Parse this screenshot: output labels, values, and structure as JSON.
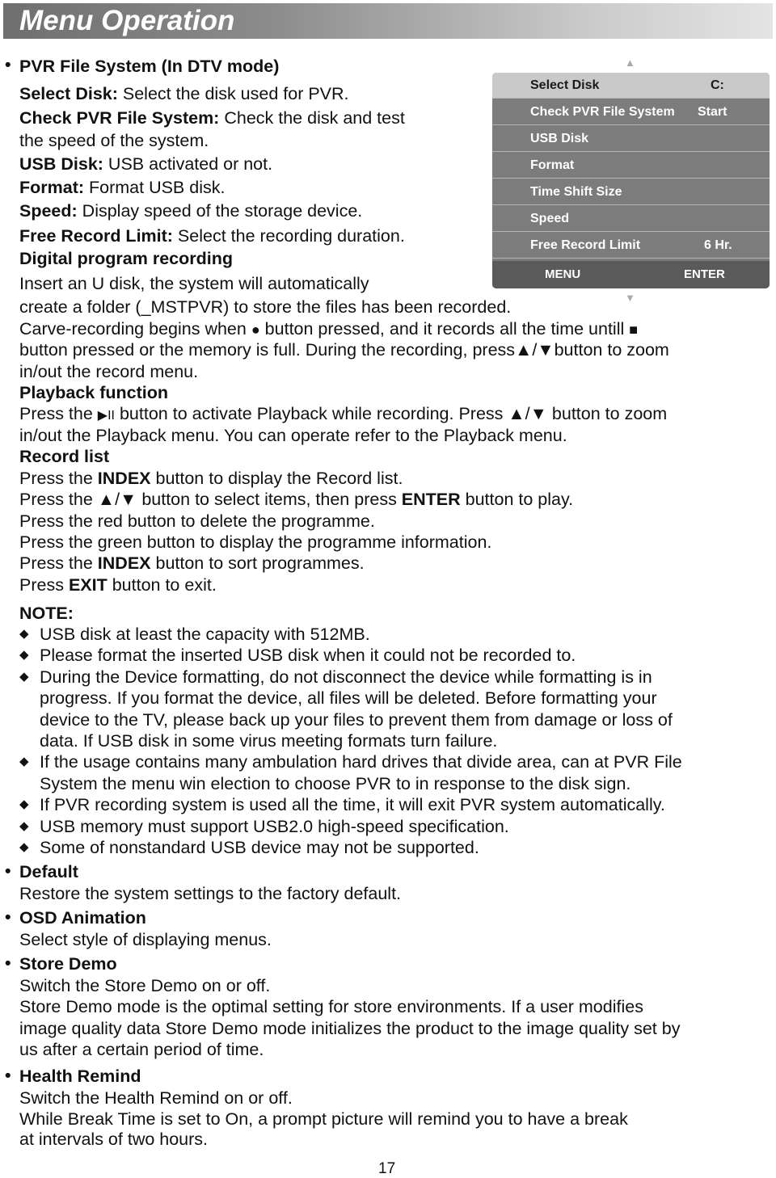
{
  "header": {
    "title": "Menu Operation"
  },
  "pvr": {
    "heading": "PVR File System (In DTV mode)",
    "items": [
      {
        "term": "Select Disk:",
        "desc": " Select the disk used for PVR."
      },
      {
        "term": "Check PVR File System:",
        "desc": " Check the disk and test"
      },
      {
        "term": "",
        "desc": "the speed of the system."
      },
      {
        "term": "USB Disk:",
        "desc": " USB activated or not."
      },
      {
        "term": "Format:",
        "desc": " Format USB disk."
      },
      {
        "term": "Speed:",
        "desc": " Display speed of the storage device."
      },
      {
        "term": "Free Record Limit:",
        "desc": " Select the recording duration."
      }
    ],
    "digital_heading": "Digital program recording",
    "digital_lines": [
      "Insert an U disk, the system will automatically",
      "create a folder (_MSTPVR) to store the files has been recorded."
    ],
    "carve": {
      "part1": "Carve-recording begins when ",
      "record_symbol": "●",
      "part2": " button pressed, and it records all the time untill ",
      "stop_symbol": "■",
      "line2a": "button pressed or the memory is full. During the recording, press",
      "updown_symbol": "▲/▼",
      "line2b": "button to zoom",
      "line3": "in/out the record menu."
    },
    "playback": {
      "heading": "Playback function",
      "line1a": "Press the ",
      "play_symbol": "▶II",
      "line1b": " button to activate Playback while recording. Press ",
      "updown_symbol": "▲/▼",
      "line1c": " button to zoom",
      "line2": "in/out the Playback menu. You can operate refer to the Playback menu."
    },
    "record_list": {
      "heading": "Record list",
      "l1a": "Press the ",
      "l1b": "INDEX",
      "l1c": " button to display the Record list.",
      "l2a": "Press the ",
      "l2sym": "▲/▼",
      "l2b": " button to select items, then press ",
      "l2c": "ENTER",
      "l2d": " button to play.",
      "l3": "Press the red button to delete the programme.",
      "l4": "Press the green button to display the programme information.",
      "l5a": "Press the ",
      "l5b": "INDEX",
      "l5c": " button to sort programmes.",
      "l6a": "Press ",
      "l6b": "EXIT",
      "l6c": " button to exit."
    }
  },
  "menu_panel": {
    "rows": [
      {
        "label": "Select Disk",
        "value": "C:"
      },
      {
        "label": "Check PVR File System",
        "value": "Start"
      },
      {
        "label": "USB Disk",
        "value": ""
      },
      {
        "label": "Format",
        "value": ""
      },
      {
        "label": "Time Shift Size",
        "value": ""
      },
      {
        "label": "Speed",
        "value": ""
      },
      {
        "label": "Free Record Limit",
        "value": "6 Hr."
      }
    ],
    "footer_left": "MENU",
    "footer_right": "ENTER",
    "arrow_up": "▲",
    "arrow_down": "▼"
  },
  "note": {
    "heading": "NOTE:",
    "bullet": "◆",
    "lines": [
      {
        "bullet": true,
        "text": "USB disk at least the capacity with 512MB."
      },
      {
        "bullet": true,
        "text": "Please format the inserted USB disk when it could not be recorded to."
      },
      {
        "bullet": true,
        "text": "During the Device formatting, do not disconnect the device while formatting is in"
      },
      {
        "bullet": false,
        "text": "progress. If you format the device, all files will be deleted. Before formatting your"
      },
      {
        "bullet": false,
        "text": "device to the TV, please back up your files to prevent them from damage or loss of"
      },
      {
        "bullet": false,
        "text": "data. If USB disk in some virus meeting formats turn failure."
      },
      {
        "bullet": true,
        "text": "If the usage contains many ambulation hard drives that divide area, can at PVR File"
      },
      {
        "bullet": false,
        "text": "System the menu win election to choose PVR to in response to the disk sign."
      },
      {
        "bullet": true,
        "text": "If PVR recording system is used all the time, it will exit PVR system automatically."
      },
      {
        "bullet": true,
        "text": "USB memory must support USB2.0 high-speed specification."
      },
      {
        "bullet": true,
        "text": "Some of nonstandard USB device may not be supported."
      }
    ]
  },
  "sections": {
    "bullet": "•",
    "default": {
      "heading": "Default",
      "lines": [
        "Restore the system settings to the factory default."
      ]
    },
    "osd": {
      "heading": "OSD Animation",
      "lines": [
        "Select style of displaying menus."
      ]
    },
    "store_demo": {
      "heading": "Store Demo",
      "lines": [
        "Switch the Store Demo on or off.",
        "Store Demo mode is the optimal setting for store environments. If a user modifies",
        "image quality data Store Demo mode initializes the product to the image quality set by",
        "us after a certain period of time."
      ]
    },
    "health": {
      "heading": "Health Remind",
      "lines": [
        "Switch the Health Remind on or off.",
        "While Break Time is set to On, a prompt picture will remind you to have a break",
        "at intervals of two hours."
      ]
    }
  },
  "page_number": "17"
}
